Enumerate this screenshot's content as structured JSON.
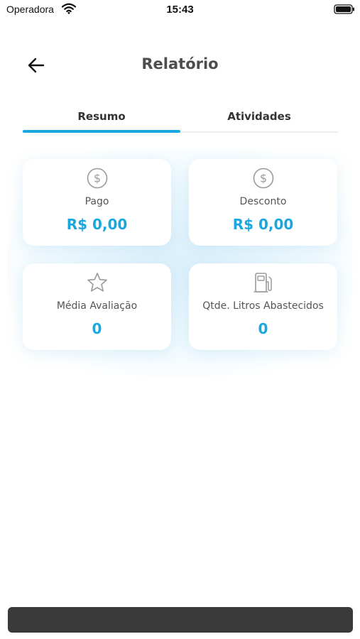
{
  "status_bar": {
    "carrier": "Operadora",
    "time": "15:43",
    "wifi_icon": "wifi-icon",
    "battery_icon": "battery-icon"
  },
  "header": {
    "back_icon": "arrow-left-icon",
    "title": "Relatório"
  },
  "tabs": [
    {
      "label": "Resumo",
      "active": true
    },
    {
      "label": "Atividades",
      "active": false
    }
  ],
  "cards": [
    {
      "icon": "dollar-circle-icon",
      "label": "Pago",
      "value": "R$ 0,00"
    },
    {
      "icon": "dollar-circle-icon",
      "label": "Desconto",
      "value": "R$ 0,00"
    },
    {
      "icon": "star-outline-icon",
      "label": "Média Avaliação",
      "value": "0"
    },
    {
      "icon": "fuel-pump-icon",
      "label": "Qtde. Litros Abastecidos",
      "value": "0"
    }
  ],
  "colors": {
    "accent": "#1aa6df",
    "title": "#4d4d4d",
    "bottom_bar": "#3a3a3a"
  }
}
